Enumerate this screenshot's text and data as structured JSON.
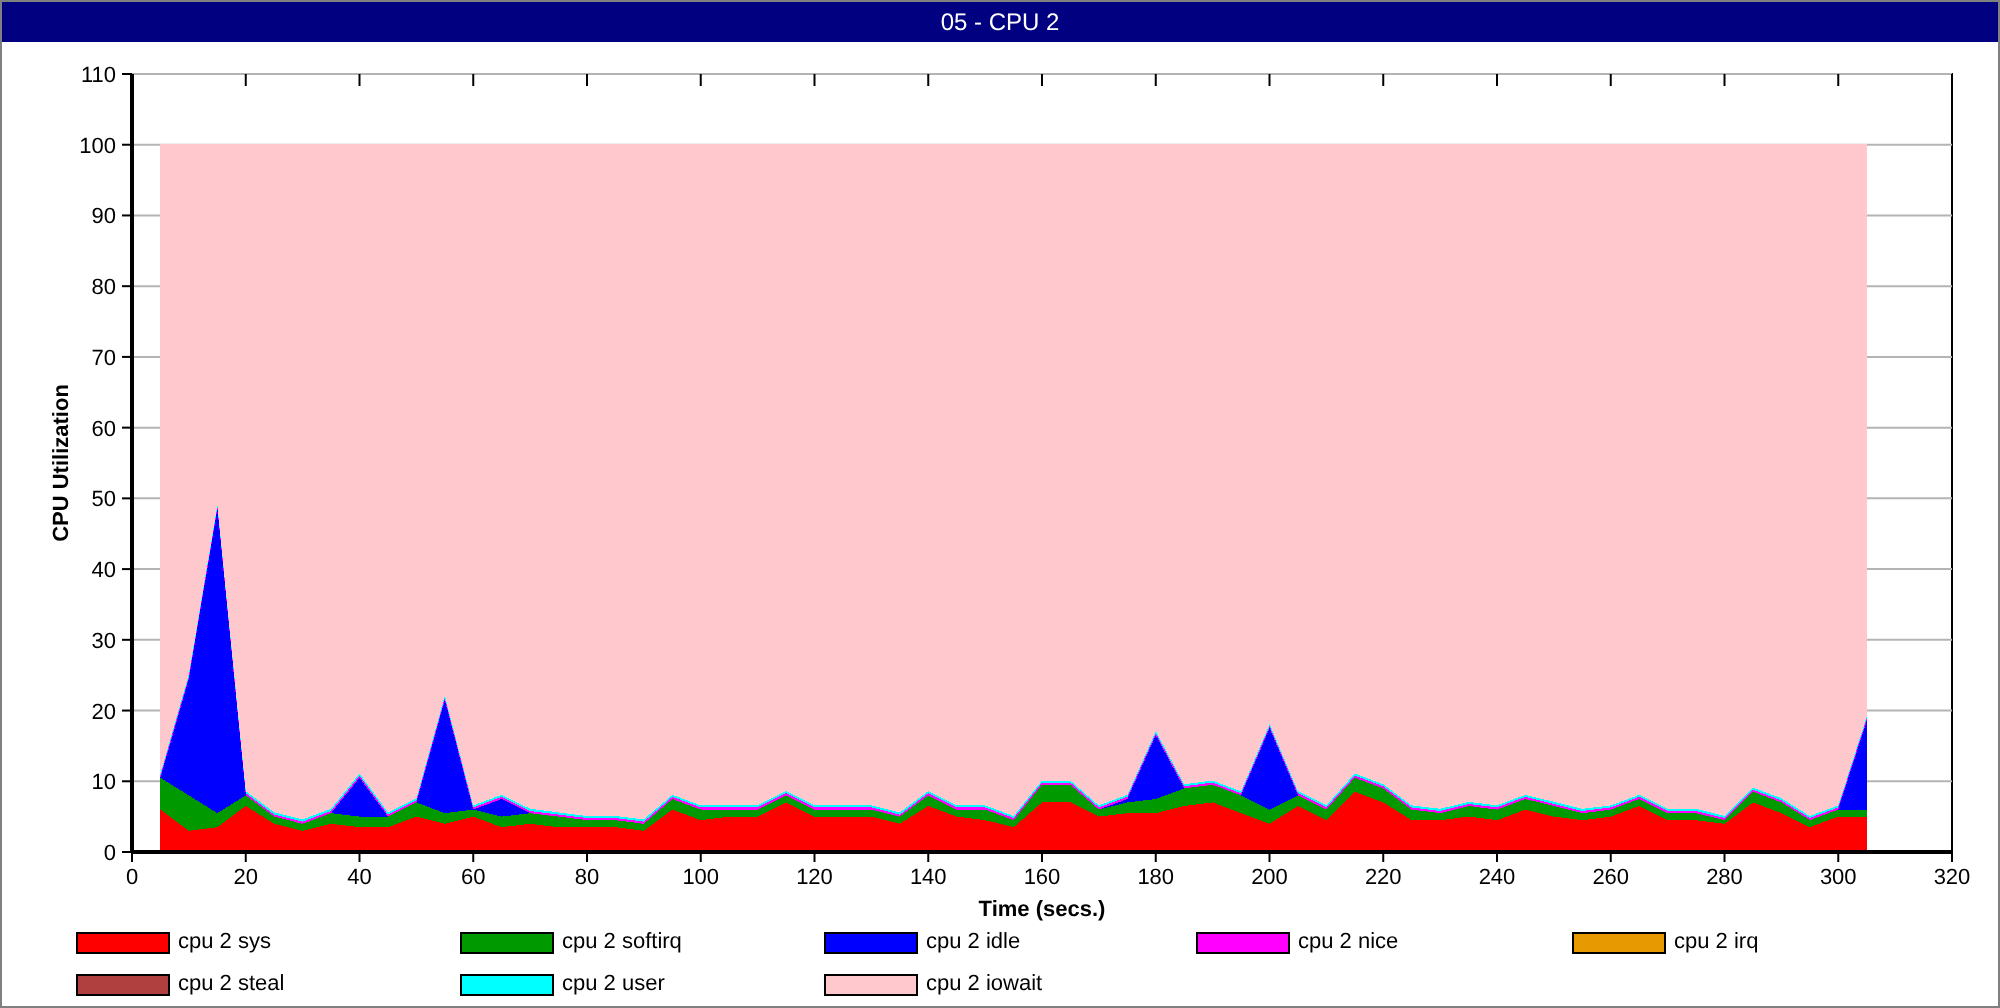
{
  "window": {
    "title": "05 - CPU 2"
  },
  "chart": {
    "chart_data": {
      "type": "area",
      "stacked": true,
      "grid": true,
      "xlabel": "Time (secs.)",
      "ylabel": "CPU Utilization",
      "xlim": [
        0,
        320
      ],
      "ylim": [
        0,
        110
      ],
      "xticks": [
        0,
        20,
        40,
        60,
        80,
        100,
        120,
        140,
        160,
        180,
        200,
        220,
        240,
        260,
        280,
        300,
        320
      ],
      "yticks": [
        0,
        10,
        20,
        30,
        40,
        50,
        60,
        70,
        80,
        90,
        100,
        110
      ],
      "x": [
        5,
        10,
        15,
        20,
        25,
        30,
        35,
        40,
        45,
        50,
        55,
        60,
        65,
        70,
        75,
        80,
        85,
        90,
        95,
        100,
        105,
        110,
        115,
        120,
        125,
        130,
        135,
        140,
        145,
        150,
        155,
        160,
        165,
        170,
        175,
        180,
        185,
        190,
        195,
        200,
        205,
        210,
        215,
        220,
        225,
        230,
        235,
        240,
        245,
        250,
        255,
        260,
        265,
        270,
        275,
        280,
        285,
        290,
        295,
        300,
        305
      ],
      "series": [
        {
          "name": "cpu 2 sys",
          "color": "#ff0000",
          "values": [
            6,
            3,
            3.5,
            6.5,
            4,
            3,
            4,
            3.5,
            3.5,
            5,
            4,
            5,
            3.5,
            4,
            3.5,
            3.5,
            3.5,
            3,
            6,
            4.5,
            5,
            5,
            7,
            5,
            5,
            5,
            4,
            6.5,
            5,
            4.5,
            3.5,
            7,
            7,
            5,
            5.5,
            5.5,
            6.5,
            7,
            5.5,
            4,
            6.5,
            4.5,
            8.5,
            7,
            4.5,
            4.5,
            5,
            4.5,
            6,
            5,
            4.5,
            5,
            6.5,
            4.5,
            4.5,
            4,
            7,
            5.5,
            3.5,
            5,
            5
          ]
        },
        {
          "name": "cpu 2 softirq",
          "color": "#009900",
          "values": [
            4.5,
            5,
            2,
            1.5,
            1,
            1,
            1.5,
            1.5,
            1.5,
            2,
            1.5,
            1,
            1.5,
            1.5,
            1.5,
            1,
            1,
            1,
            1.5,
            1.5,
            1,
            1,
            1,
            1,
            1,
            1,
            1,
            1.5,
            1,
            1.5,
            1,
            2.5,
            2.5,
            1,
            1.5,
            2,
            2.5,
            2.5,
            2.5,
            2,
            1.5,
            1.5,
            2,
            2,
            1.5,
            1,
            1.5,
            1.5,
            1.5,
            1.5,
            1,
            1,
            1,
            1,
            1,
            0.5,
            1.5,
            1.5,
            1,
            1,
            1
          ]
        },
        {
          "name": "cpu 2 idle",
          "color": "#0000ff",
          "values": [
            0,
            16.5,
            43,
            0,
            0,
            0,
            0,
            5.5,
            0,
            0,
            16,
            0,
            2.5,
            0,
            0,
            0,
            0,
            0,
            0,
            0,
            0,
            0,
            0,
            0,
            0,
            0,
            0,
            0,
            0,
            0,
            0,
            0,
            0,
            0,
            0.5,
            9,
            0,
            0,
            0,
            11.5,
            0,
            0,
            0,
            0,
            0,
            0,
            0,
            0,
            0,
            0,
            0,
            0,
            0,
            0,
            0,
            0,
            0,
            0,
            0,
            0,
            12.5
          ]
        },
        {
          "name": "cpu 2 nice",
          "color": "#ff00ff",
          "values": [
            0.3,
            0.3,
            0.3,
            0.3,
            0.3,
            0.3,
            0.3,
            0.3,
            0.3,
            0.3,
            0.3,
            0.3,
            0.3,
            0.3,
            0.3,
            0.3,
            0.3,
            0.3,
            0.3,
            0.3,
            0.3,
            0.3,
            0.3,
            0.3,
            0.3,
            0.3,
            0.3,
            0.3,
            0.3,
            0.3,
            0.3,
            0.3,
            0.3,
            0.3,
            0.3,
            0.3,
            0.3,
            0.3,
            0.3,
            0.3,
            0.3,
            0.3,
            0.3,
            0.3,
            0.3,
            0.3,
            0.3,
            0.3,
            0.3,
            0.3,
            0.3,
            0.3,
            0.3,
            0.3,
            0.3,
            0.3,
            0.3,
            0.3,
            0.3,
            0.3,
            0.3
          ]
        },
        {
          "name": "cpu 2 irq",
          "color": "#e69900",
          "values": [
            null,
            null,
            null,
            null,
            null,
            null,
            null,
            null,
            null,
            null,
            null,
            null,
            null,
            null,
            null,
            null,
            null,
            null,
            null,
            null,
            null,
            null,
            null,
            null,
            null,
            null,
            null,
            null,
            null,
            null,
            null,
            null,
            null,
            null,
            null,
            null,
            null,
            null,
            null,
            null,
            null,
            null,
            null,
            null,
            null,
            null,
            null,
            null,
            null,
            null,
            null,
            null,
            null,
            null,
            null,
            null,
            null,
            null,
            null,
            null,
            null
          ]
        },
        {
          "name": "cpu 2 steal",
          "color": "#b04040",
          "values": [
            null,
            null,
            null,
            null,
            null,
            null,
            null,
            null,
            null,
            null,
            null,
            null,
            null,
            null,
            null,
            null,
            null,
            null,
            null,
            null,
            null,
            null,
            null,
            null,
            null,
            null,
            null,
            null,
            null,
            null,
            null,
            null,
            null,
            null,
            null,
            null,
            null,
            null,
            null,
            null,
            null,
            null,
            null,
            null,
            null,
            null,
            null,
            null,
            null,
            null,
            null,
            null,
            null,
            null,
            null,
            null,
            null,
            null,
            null,
            null,
            null
          ]
        },
        {
          "name": "cpu 2 user",
          "color": "#00ffff",
          "values": [
            0.3,
            0.3,
            0.3,
            0.3,
            0.3,
            0.3,
            0.3,
            0.3,
            0.3,
            0.3,
            0.3,
            0.3,
            0.3,
            0.3,
            0.3,
            0.3,
            0.3,
            0.3,
            0.3,
            0.3,
            0.3,
            0.3,
            0.3,
            0.3,
            0.3,
            0.3,
            0.3,
            0.3,
            0.3,
            0.3,
            0.3,
            0.3,
            0.3,
            0.3,
            0.3,
            0.3,
            0.3,
            0.3,
            0.3,
            0.3,
            0.3,
            0.3,
            0.3,
            0.3,
            0.3,
            0.3,
            0.3,
            0.3,
            0.3,
            0.3,
            0.3,
            0.3,
            0.3,
            0.3,
            0.3,
            0.3,
            0.3,
            0.3,
            0.3,
            0.3,
            0.3
          ]
        },
        {
          "name": "cpu 2 iowait",
          "color": "#ffc8cc",
          "values": [
            89,
            75,
            51,
            91.5,
            94.5,
            95.5,
            94,
            89,
            94.5,
            92.5,
            78,
            93.5,
            92,
            94,
            94.5,
            95,
            95,
            95.5,
            92,
            93.5,
            93.5,
            93.5,
            91.5,
            93.5,
            93.5,
            93.5,
            94.5,
            91.5,
            93.5,
            93.5,
            95,
            90,
            90,
            93.5,
            92,
            83,
            90.5,
            90,
            91.5,
            82,
            91.5,
            93.5,
            89,
            90.5,
            93.5,
            94,
            93,
            93.5,
            92,
            93,
            94,
            93.5,
            92,
            94,
            94,
            95,
            91,
            92.5,
            95,
            93.5,
            81
          ]
        }
      ]
    }
  }
}
